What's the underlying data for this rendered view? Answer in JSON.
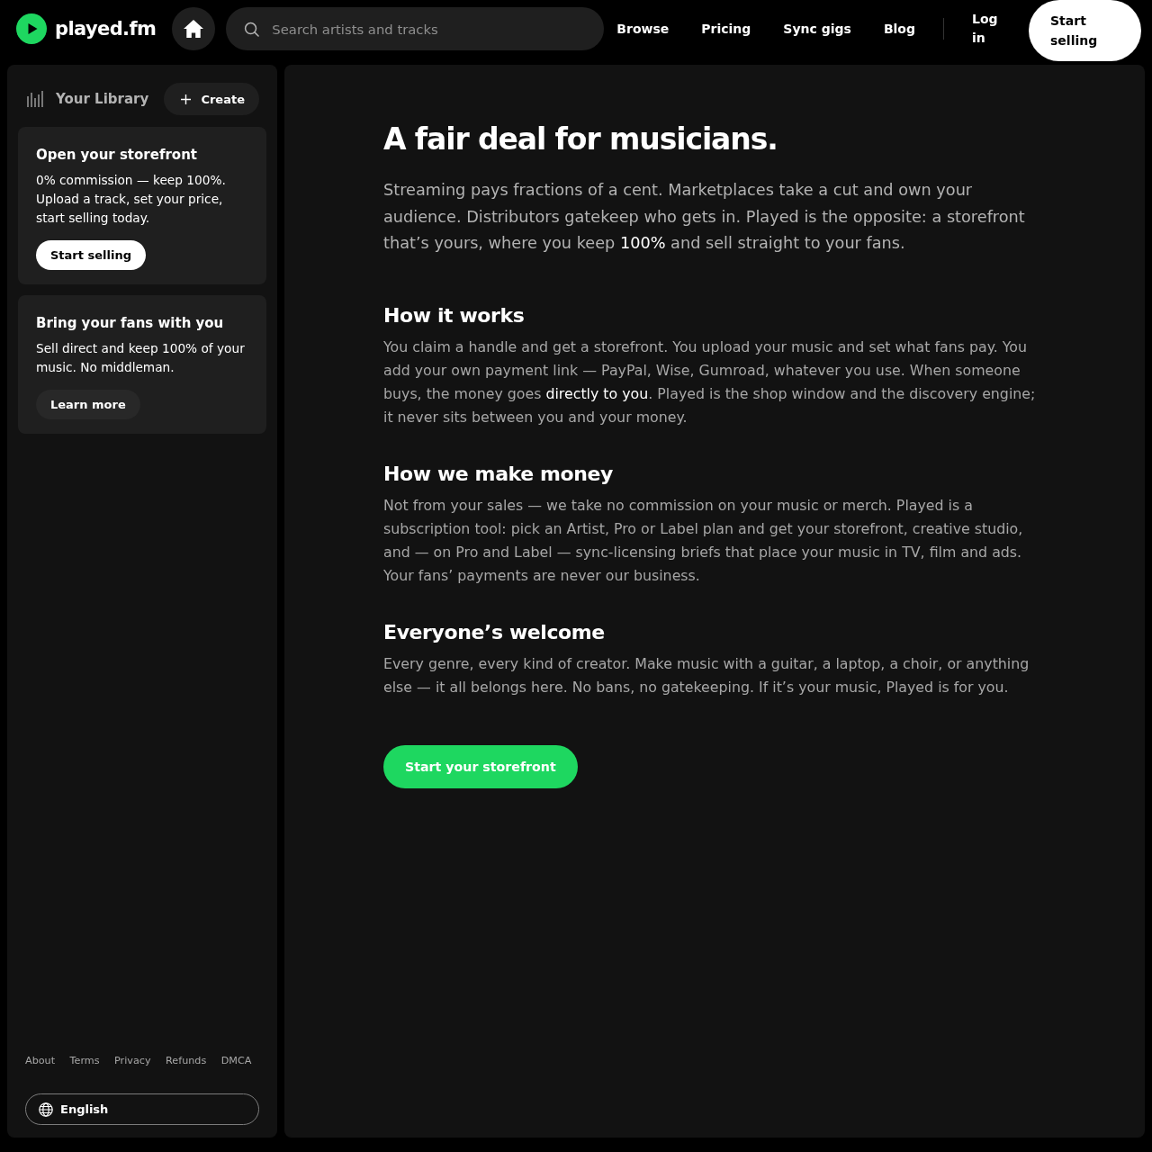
{
  "header": {
    "logo": "played.fm",
    "search": {
      "placeholder": "Search artists and tracks"
    },
    "nav": [
      "Browse",
      "Pricing",
      "Sync gigs",
      "Blog"
    ],
    "login": "Log in",
    "cta": "Start selling"
  },
  "sidebar": {
    "title": "Your Library",
    "create": "Create",
    "cards": [
      {
        "kind": "primary",
        "title": "Open your storefront",
        "text": "0% commission — keep 100%. Upload a track, set your price, start selling today.",
        "button": "Start selling"
      },
      {
        "kind": "secondary",
        "title": "Bring your fans with you",
        "text": "Sell direct and keep 100% of your music. No middleman.",
        "button": "Learn more"
      }
    ],
    "footer_links": [
      "About",
      "Terms",
      "Privacy",
      "Refunds",
      "DMCA"
    ],
    "language": "English"
  },
  "main": {
    "title": "A fair deal for musicians.",
    "lead": "Streaming pays fractions of a cent. Marketplaces take a cut and own your audience. Distributors gatekeep who gets in. Played is the opposite: a storefront that’s yours, where you keep **100%** and sell straight to your fans.",
    "sections": [
      {
        "heading": "How it works",
        "text": "You claim a handle and get a storefront. You upload your music and set what fans pay. You add your own payment link — PayPal, Wise, Gumroad, whatever you use. When someone buys, the money goes **directly to you**. Played is the shop window and the discovery engine; it never sits between you and your money."
      },
      {
        "heading": "How we make money",
        "text": "Not from your sales — we take no commission on your music or merch. Played is a subscription tool: pick an Artist, Pro or Label plan and get your storefront, creative studio, and — on Pro and Label — sync-licensing briefs that place your music in TV, film and ads. Your fans’ payments are never our business."
      },
      {
        "heading": "Everyone’s welcome",
        "text": "Every genre, every kind of creator. Make music with a guitar, a laptop, a choir, or anything else — it all belongs here. No bans, no gatekeeping. If it’s your music, Played is for you."
      }
    ],
    "cta": "Start your storefront"
  }
}
